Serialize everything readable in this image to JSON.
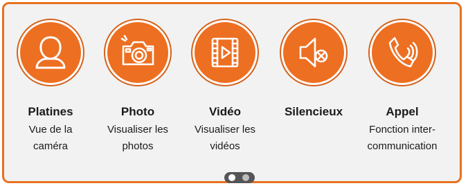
{
  "features": [
    {
      "icon": "user-icon",
      "title": "Platines",
      "description": "Vue de la caméra"
    },
    {
      "icon": "camera-icon",
      "title": "Photo",
      "description": "Visualiser les photos"
    },
    {
      "icon": "video-icon",
      "title": "Vidéo",
      "description": "Visualiser les vidéos"
    },
    {
      "icon": "mute-icon",
      "title": "Silencieux",
      "description": ""
    },
    {
      "icon": "phone-call-icon",
      "title": "Appel",
      "description": "Fonction inter-communication"
    }
  ],
  "pagination": {
    "pages": 2,
    "current": 1
  },
  "colors": {
    "accent": "#ed6f21",
    "border": "#e8711f",
    "panel": "#f2f2f2",
    "dots_bg": "#555555"
  }
}
